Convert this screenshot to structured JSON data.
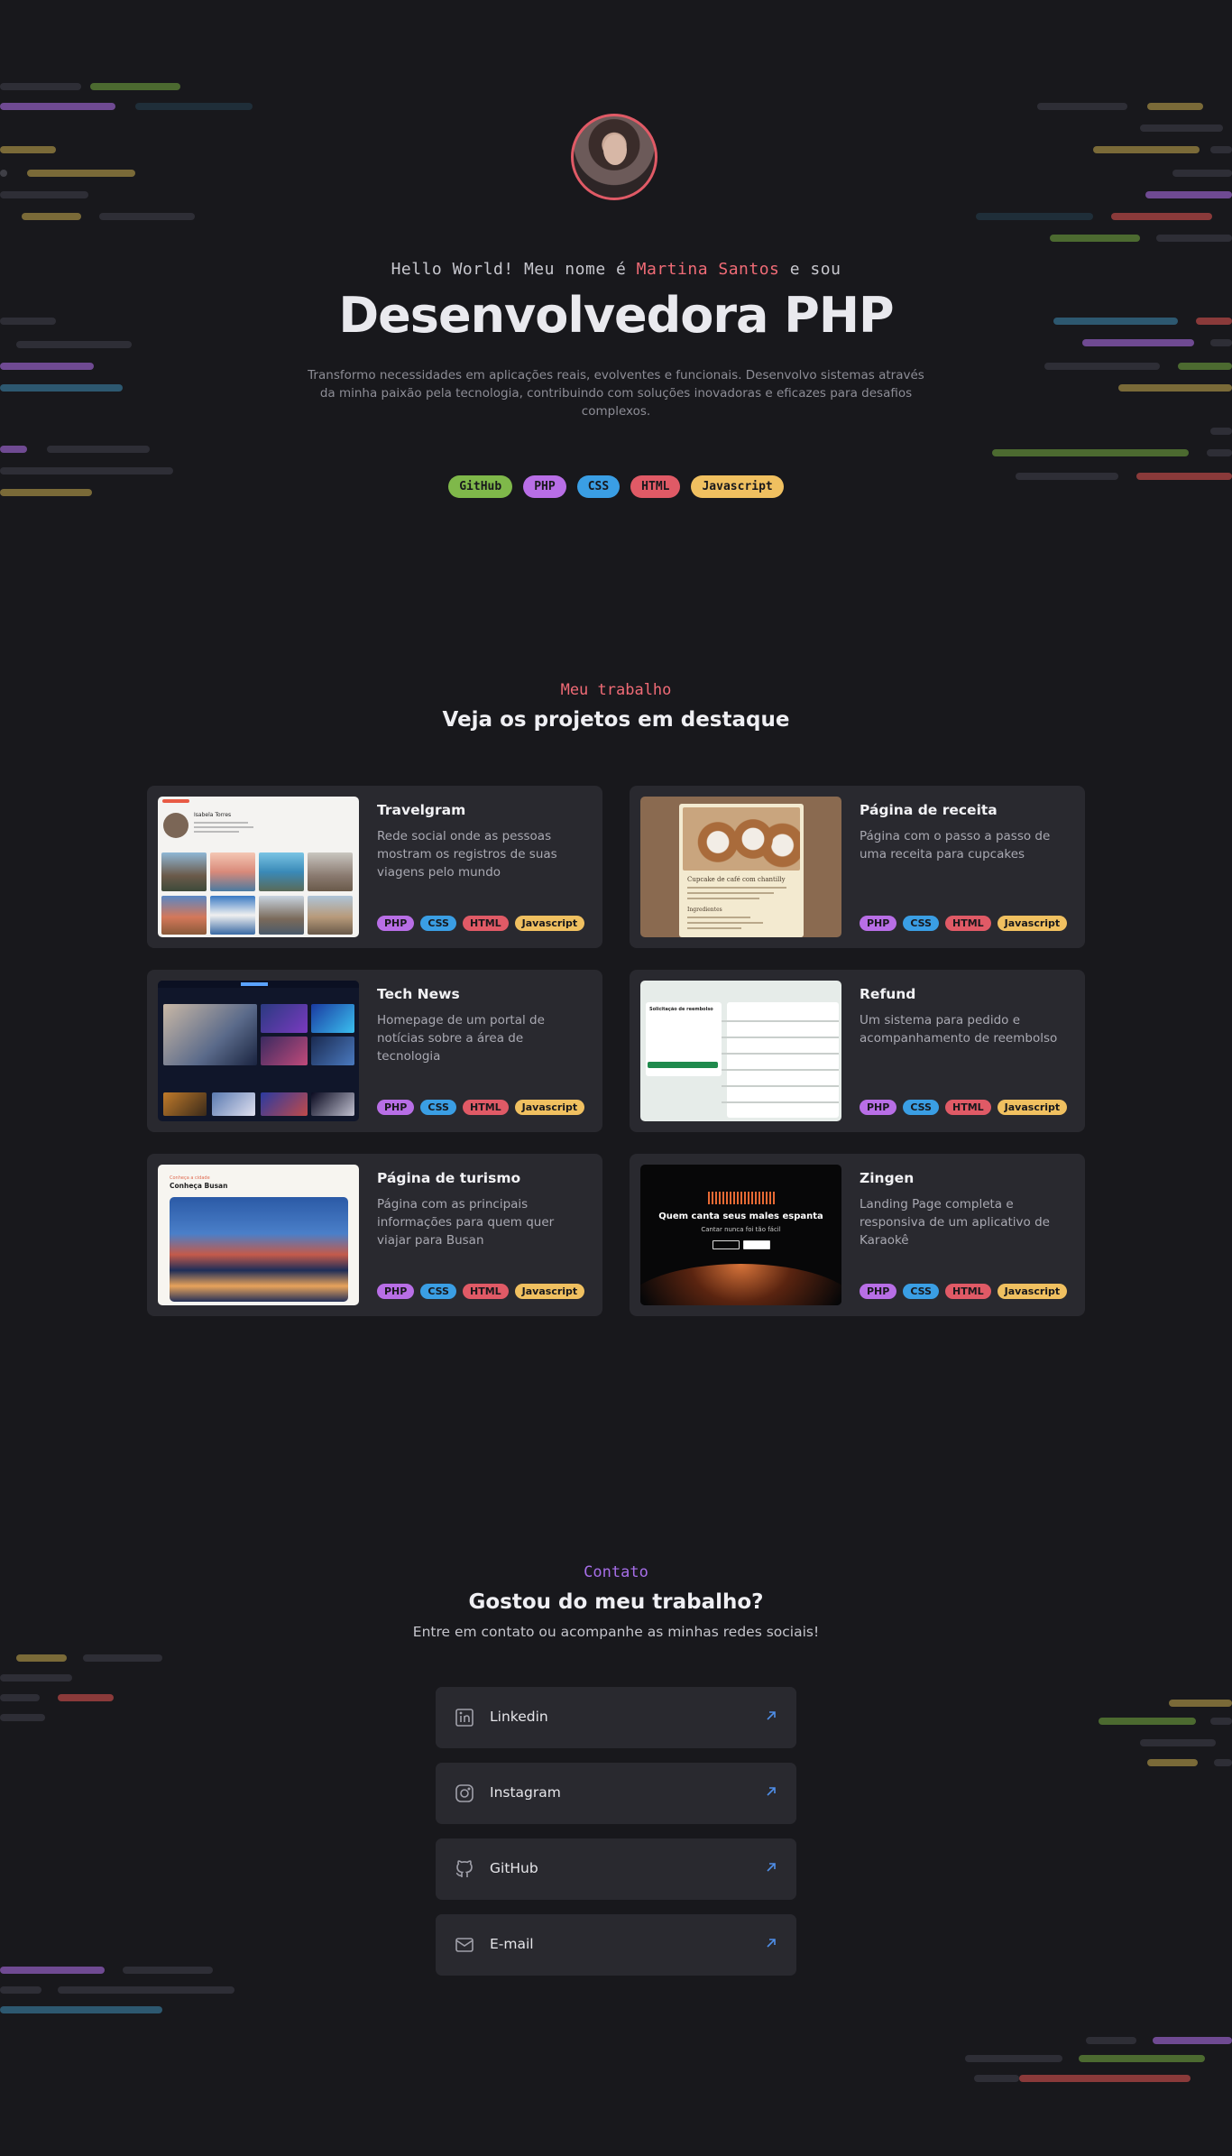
{
  "colors": {
    "background": "#18181c",
    "card": "#29292f",
    "accent_pink": "#f06b76",
    "accent_purple": "#a66ee8",
    "github": "#7fb84a",
    "php": "#b86ee6",
    "css": "#3a9ee4",
    "html": "#e05a66",
    "javascript": "#f0c060",
    "link_arrow": "#4f8ee8"
  },
  "hero": {
    "greeting_prefix": "Hello World! Meu nome é",
    "name": "Martina Santos",
    "greeting_suffix": "e sou",
    "role": "Desenvolvedora PHP",
    "intro": "Transformo necessidades em aplicações reais, evolventes e funcionais. Desenvolvo sistemas através da minha paixão pela tecnologia, contribuindo com soluções inovadoras e eficazes para desafios complexos.",
    "badges": [
      {
        "label": "GitHub",
        "color": "#7fb84a"
      },
      {
        "label": "PHP",
        "color": "#b86ee6"
      },
      {
        "label": "CSS",
        "color": "#3a9ee4"
      },
      {
        "label": "HTML",
        "color": "#e05a66"
      },
      {
        "label": "Javascript",
        "color": "#f0c060"
      }
    ]
  },
  "work": {
    "eyebrow": "Meu trabalho",
    "title": "Veja os projetos em destaque",
    "projects": [
      {
        "title": "Travelgram",
        "desc": "Rede social onde as pessoas mostram os registros de suas viagens pelo mundo",
        "tags": [
          "PHP",
          "CSS",
          "HTML",
          "Javascript"
        ]
      },
      {
        "title": "Página de receita",
        "desc": "Página com o passo a passo de uma receita para cupcakes",
        "tags": [
          "PHP",
          "CSS",
          "HTML",
          "Javascript"
        ]
      },
      {
        "title": "Tech News",
        "desc": "Homepage de um portal de notícias sobre a área de tecnologia",
        "tags": [
          "PHP",
          "CSS",
          "HTML",
          "Javascript"
        ]
      },
      {
        "title": "Refund",
        "desc": "Um sistema para pedido e acompanhamento de reembolso",
        "tags": [
          "PHP",
          "CSS",
          "HTML",
          "Javascript"
        ]
      },
      {
        "title": "Página de turismo",
        "desc": "Página com as principais informações para quem quer viajar para Busan",
        "tags": [
          "PHP",
          "CSS",
          "HTML",
          "Javascript"
        ]
      },
      {
        "title": "Zingen",
        "desc": "Landing Page completa e responsiva de um aplicativo de Karaokê",
        "tags": [
          "PHP",
          "CSS",
          "HTML",
          "Javascript"
        ]
      }
    ],
    "thumb_text": {
      "travel_name": "Isabela Torres",
      "recipe_title": "Cupcake de café com chantilly",
      "recipe_section": "Ingredientes",
      "refund_title": "Solicitação de reembolso",
      "tour_kicker": "Conheça a cidade",
      "tour_title": "Conheça Busan",
      "zing_headline": "Quem canta seus males espanta",
      "zing_sub": "Cantar nunca foi tão fácil"
    }
  },
  "contact": {
    "eyebrow": "Contato",
    "title": "Gostou do meu trabalho?",
    "subtitle": "Entre em contato ou acompanhe as minhas redes sociais!",
    "links": [
      {
        "label": "Linkedin",
        "icon": "linkedin-icon"
      },
      {
        "label": "Instagram",
        "icon": "instagram-icon"
      },
      {
        "label": "GitHub",
        "icon": "github-icon"
      },
      {
        "label": "E-mail",
        "icon": "mail-icon"
      }
    ]
  }
}
